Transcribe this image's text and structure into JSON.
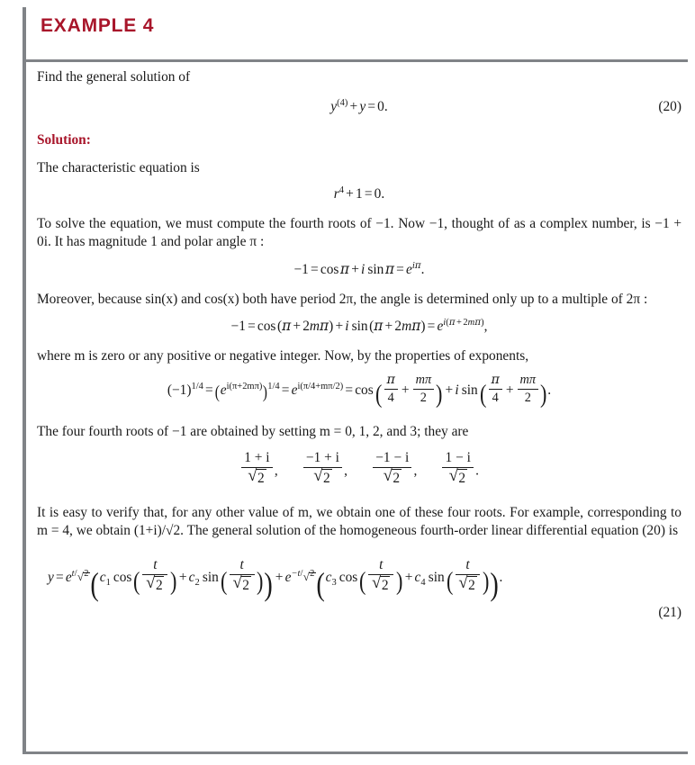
{
  "header": {
    "title": "EXAMPLE 4",
    "accent_color": "#a8152a",
    "rule_color": "#808387"
  },
  "body": {
    "intro": "Find the general solution of",
    "solution_label": "Solution:",
    "char_eq_intro": "The characteristic equation is",
    "para_roots": "To solve the equation, we must compute the fourth roots of −1. Now −1, thought of as a complex number, is −1 + 0i. It has magnitude 1 and polar angle π :",
    "para_period": "Moreover, because sin(x) and cos(x) both have period 2π, the angle is determined only up to a multiple of 2π :",
    "para_integer": "where m is zero or any positive or negative integer. Now, by the properties of exponents,",
    "para_four_roots": "The four fourth roots of −1 are obtained by setting m = 0, 1, 2, and 3; they are",
    "para_verify": "It is easy to verify that, for any other value of m, we obtain one of these four roots. For example, corresponding to m = 4, we obtain (1+i)/√2. The general solution of the homogeneous fourth-order linear differential equation (20) is"
  },
  "equations": {
    "eq20": {
      "number": "(20)",
      "latex": "y^{(4)} + y = 0.",
      "parts": {
        "y": "y",
        "sup": "(4)",
        "plus": "+",
        "y2": "y",
        "eq": "=",
        "zero": "0."
      }
    },
    "char_eq": {
      "latex": "r^4 + 1 = 0.",
      "parts": {
        "r": "r",
        "sup": "4",
        "plus": "+",
        "one": "1",
        "eq": "=",
        "zero": "0."
      }
    },
    "euler": {
      "latex": "-1 = \\cos \\pi + i \\sin \\pi = e^{i\\pi}.",
      "parts": {
        "lhs": "−1",
        "eq": "=",
        "cos": "cos",
        "pi1": "π",
        "plus": "+",
        "i": "i",
        "sin": "sin",
        "pi2": "π",
        "eq2": "=",
        "e": "e",
        "exp_i": "i",
        "exp_pi": "π",
        "period": "."
      }
    },
    "euler_general": {
      "latex": "-1 = \\cos(\\pi + 2m\\pi) + i \\sin(\\pi + 2m\\pi) = e^{i(\\pi+2m\\pi)},",
      "parts": {
        "lhs": "−1",
        "eq": "=",
        "cos": "cos",
        "open": "(",
        "pi": "π",
        "plus": "+",
        "two": "2",
        "m": "m",
        "pi_b": "π",
        "close": ")",
        "plus2": "+",
        "i": "i",
        "sin": "sin",
        "eq2": "=",
        "e": "e",
        "comma": ","
      }
    },
    "fourth_root": {
      "latex": "(-1)^{1/4} = (e^{i(\\pi+2m\\pi)})^{1/4} = e^{i(\\pi/4+m\\pi/2)} = \\cos(\\pi/4 + m\\pi/2) + i\\sin(\\pi/4 + m\\pi/2).",
      "parts": {
        "open": "(",
        "minus_one": "−1",
        "close": ")",
        "exp14": "1/4",
        "eq": "=",
        "e": "e",
        "inner_exp": "i(π+2mπ)",
        "eq2": "=",
        "e2": "e",
        "exp2": "i(π/4+mπ/2)",
        "eq3": "=",
        "cos": "cos",
        "pi": "π",
        "four": "4",
        "plus": "+",
        "mpi": "mπ",
        "two": "2",
        "plus2": "+",
        "i": "i",
        "sin": "sin",
        "period": "."
      }
    },
    "roots": {
      "items": [
        {
          "num": "1 + i",
          "den": "2",
          "sep": ","
        },
        {
          "num": "−1 + i",
          "den": "2",
          "sep": ","
        },
        {
          "num": "−1 − i",
          "den": "2",
          "sep": ","
        },
        {
          "num": "1 − i",
          "den": "2",
          "sep": "."
        }
      ],
      "radical": "√"
    },
    "eq21": {
      "number": "(21)",
      "latex": "y = e^{t/\\sqrt{2}}\\left(c_1\\cos\\left(\\frac{t}{\\sqrt2}\\right)+c_2\\sin\\left(\\frac{t}{\\sqrt2}\\right)\\right)+e^{-t/\\sqrt2}\\left(c_3\\cos\\left(\\frac{t}{\\sqrt2}\\right)+c_4\\sin\\left(\\frac{t}{\\sqrt2}\\right)\\right).",
      "parts": {
        "y": "y",
        "eq": "=",
        "e": "e",
        "exp_t": "t",
        "exp_slash": "/",
        "exp_two": "2",
        "c1": "c",
        "c1_sub": "1",
        "cos": "cos",
        "t": "t",
        "two": "2",
        "plus": "+",
        "c2": "c",
        "c2_sub": "2",
        "sin": "sin",
        "plus_mid": "+",
        "e2": "e",
        "exp_neg_t": "−t",
        "c3": "c",
        "c3_sub": "3",
        "c4": "c",
        "c4_sub": "4",
        "period": "."
      }
    }
  }
}
